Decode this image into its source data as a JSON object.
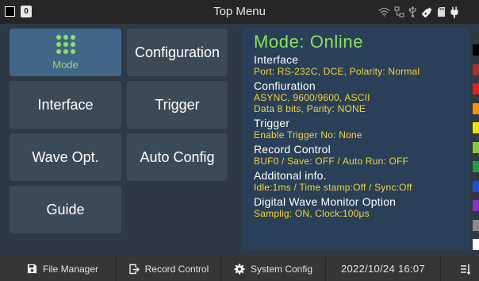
{
  "header": {
    "title": "Top Menu",
    "status_indicator_icon": "stop-square-icon",
    "badge_value": "0",
    "system_icons": [
      "wifi-icon",
      "network-icon",
      "usb-icon",
      "usb-memory-icon",
      "sd-card-icon",
      "power-plug-icon"
    ]
  },
  "menu": {
    "buttons": [
      {
        "label": "Mode",
        "icon": "grid-dots-icon",
        "selected": true
      },
      {
        "label": "Configuration"
      },
      {
        "label": "Interface"
      },
      {
        "label": "Trigger"
      },
      {
        "label": "Wave Opt."
      },
      {
        "label": "Auto Config"
      },
      {
        "label": "Guide"
      }
    ]
  },
  "info": {
    "title": "Mode: Online",
    "sections": [
      {
        "heading": "Interface",
        "lines": [
          "Port: RS-232C, DCE, Polarity: Normal"
        ]
      },
      {
        "heading": "Confiuration",
        "lines": [
          "ASYNC, 9600/9600, ASCII",
          "Data 8 bits, Parity: NONE"
        ]
      },
      {
        "heading": "Trigger",
        "lines": [
          "Enable Trigger No: None"
        ]
      },
      {
        "heading": "Record Control",
        "lines": [
          "BUF0 / Save: OFF / Auto Run: OFF"
        ]
      },
      {
        "heading": "Additonal info.",
        "lines": [
          "Idle:1ms / Time stamp:Off / Sync:Off"
        ]
      },
      {
        "heading": "Digital Wave Monitor Option",
        "lines": [
          "Samplig: ON, Clock:100μs"
        ]
      }
    ]
  },
  "color_code_strip": [
    "#000000",
    "#a3302a",
    "#e3201c",
    "#f39200",
    "#f2e200",
    "#8cc63e",
    "#1f9e3c",
    "#1e4fd8",
    "#8b2fc9",
    "#8a8a8a",
    "#ffffff"
  ],
  "footer": {
    "tabs": [
      {
        "label": "File Manager",
        "icon": "floppy-disk-icon"
      },
      {
        "label": "Record Control",
        "icon": "file-export-icon"
      },
      {
        "label": "System Config",
        "icon": "gear-icon"
      }
    ],
    "datetime": "2022/10/24 16:07",
    "menu_icon": "menu-icon"
  },
  "colors": {
    "selected_button": "#41668a",
    "accent_green": "#8de05e",
    "value_yellow": "#f5d23a",
    "heading_white": "#ffffff"
  }
}
